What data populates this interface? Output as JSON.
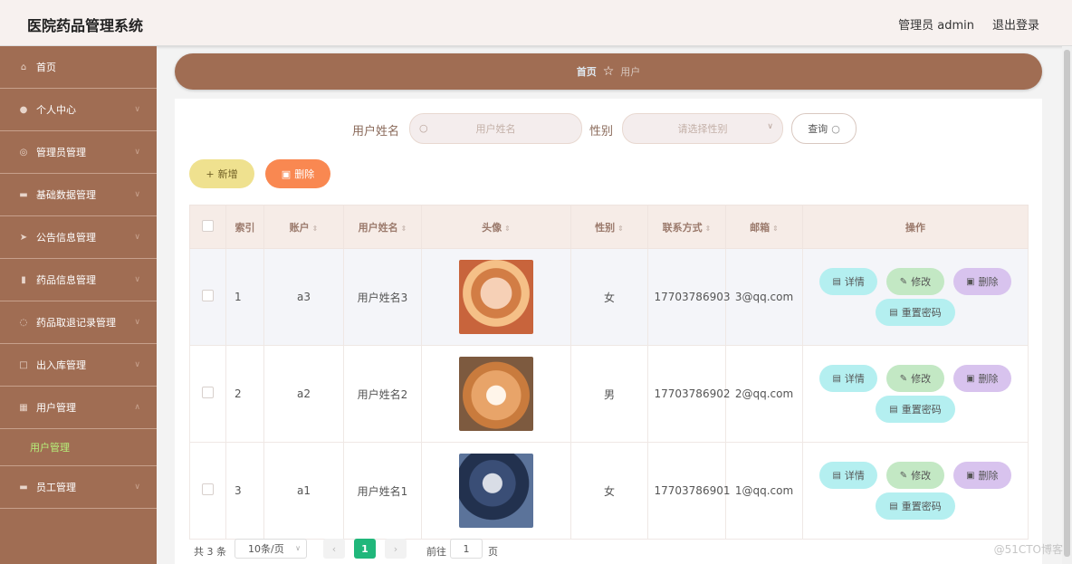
{
  "app": {
    "title": "医院药品管理系统",
    "admin_label": "管理员 admin",
    "logout": "退出登录"
  },
  "sidebar": {
    "items": [
      {
        "label": "首页",
        "icon": "home-icon"
      },
      {
        "label": "个人中心",
        "icon": "user-icon"
      },
      {
        "label": "管理员管理",
        "icon": "settings-icon"
      },
      {
        "label": "基础数据管理",
        "icon": "data-icon"
      },
      {
        "label": "公告信息管理",
        "icon": "send-icon"
      },
      {
        "label": "药品信息管理",
        "icon": "chart-icon"
      },
      {
        "label": "药品取退记录管理",
        "icon": "circle-icon"
      },
      {
        "label": "出入库管理",
        "icon": "box-icon"
      },
      {
        "label": "用户管理",
        "icon": "grid-icon"
      },
      {
        "label": "员工管理",
        "icon": "briefcase-icon"
      }
    ],
    "submenu_active": "用户管理"
  },
  "breadcrumb": {
    "home": "首页",
    "current": "用户"
  },
  "search": {
    "name_label": "用户姓名",
    "name_placeholder": "用户姓名",
    "gender_label": "性别",
    "gender_placeholder": "请选择性别",
    "query_label": "查询"
  },
  "actions": {
    "add": "新增",
    "delete": "删除"
  },
  "table": {
    "headers": [
      "索引",
      "账户",
      "用户姓名",
      "头像",
      "性别",
      "联系方式",
      "邮箱",
      "操作"
    ],
    "rows": [
      {
        "index": "1",
        "account": "a3",
        "name": "用户姓名3",
        "gender": "女",
        "phone": "17703786903",
        "email": "3@qq.com"
      },
      {
        "index": "2",
        "account": "a2",
        "name": "用户姓名2",
        "gender": "男",
        "phone": "17703786902",
        "email": "2@qq.com"
      },
      {
        "index": "3",
        "account": "a1",
        "name": "用户姓名1",
        "gender": "女",
        "phone": "17703786901",
        "email": "1@qq.com"
      }
    ],
    "op_labels": {
      "detail": "详情",
      "edit": "修改",
      "delete": "删除",
      "reset": "重置密码"
    }
  },
  "pagination": {
    "total": "共 3 条",
    "page_size": "10条/页",
    "current_page": "1",
    "goto_label": "前往",
    "goto_value": "1",
    "page_suffix": "页"
  },
  "watermark": "@51CTO博客"
}
